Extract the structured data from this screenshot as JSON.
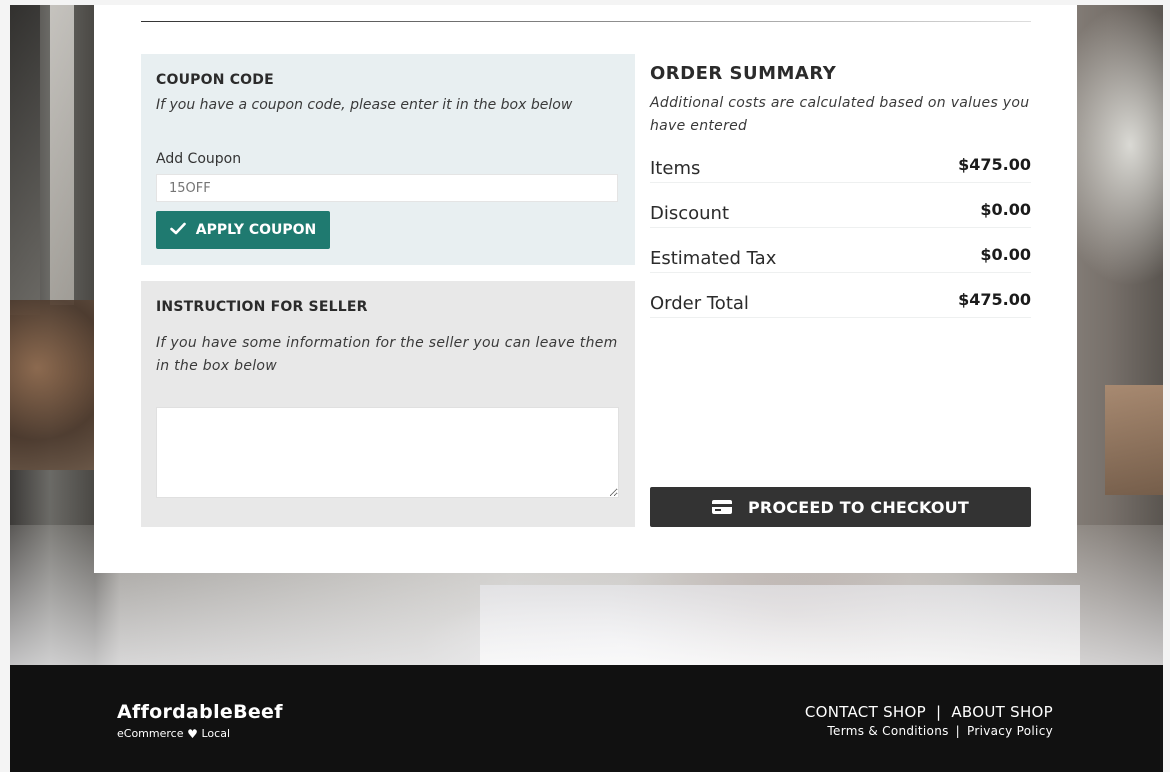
{
  "coupon": {
    "title": "COUPON CODE",
    "subtitle": "If you have a coupon code, please enter it in the box below",
    "label": "Add Coupon",
    "placeholder": "15OFF",
    "button_label": "APPLY COUPON"
  },
  "instructions": {
    "title": "INSTRUCTION FOR SELLER",
    "subtitle": "If you have some information for the seller you can leave them in the box below",
    "value": ""
  },
  "summary": {
    "title": "ORDER SUMMARY",
    "subtitle": "Additional costs are calculated based on values you have entered",
    "rows": [
      {
        "label": "Items",
        "value": "$475.00"
      },
      {
        "label": "Discount",
        "value": "$0.00"
      },
      {
        "label": "Estimated Tax",
        "value": "$0.00"
      },
      {
        "label": "Order Total",
        "value": "$475.00"
      }
    ],
    "checkout_label": "PROCEED TO CHECKOUT"
  },
  "footer": {
    "brand": "AffordableBeef",
    "tagline_left": "eCommerce",
    "tagline_right": "Local",
    "links": [
      "CONTACT SHOP",
      "ABOUT SHOP"
    ],
    "link_separator": "|",
    "small_links": [
      "Terms & Conditions",
      "Privacy Policy"
    ]
  },
  "colors": {
    "accent": "#1f7a70",
    "checkout": "#333333",
    "footer_bg": "#111111"
  },
  "icons": [
    "check-icon",
    "credit-card-icon",
    "heart-icon"
  ]
}
